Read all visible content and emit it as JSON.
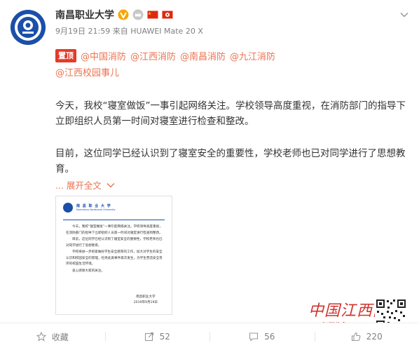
{
  "post": {
    "username": "南昌职业大学",
    "time": "9月19日 21:59",
    "source_prefix": "来自",
    "device": "HUAWEI Mate 20 X",
    "pinned_label": "置顶",
    "mentions_line1": [
      "@中国消防",
      "@江西消防",
      "@南昌消防",
      "@九江消防"
    ],
    "mentions_line2": [
      "@江西校园事儿"
    ],
    "paragraph1": "今天，我校“寝室做饭”一事引起网络关注。学校领导高度重视，在消防部门的指导下立即组织人员第一时间对寝室进行检查和整改。",
    "paragraph2": "目前，这位同学已经认识到了寝室安全的重要性，学校老师也已对同学进行了思想教育。",
    "expand_label": "... 展开全文",
    "image_doc": {
      "title": "南 昌 职 业 大 学",
      "subtitle": "Nanchang Vocational University",
      "body": [
        "今天，我校“寝室做饭”一事引起网络关注。学校领导高度重视，在消防部门的指导下立即组织人员第一时间对寝室进行检查和整改。",
        "目前，这位同学已经认识到了寝室安全的重要性，学校老师也已对同学进行了思想教育。",
        "学校将进一步抓紧做好学生安全教育的工作，加大对学生的安全认识和校园安全的管理，杜绝此类事件再次发生，为学生营造安全有序的校园生活环境。",
        "衷心感谢大家的关注。"
      ],
      "signature": "南昌职业大学",
      "date": "2019年9月19日"
    },
    "watermark_title": "中国江西网",
    "watermark_sub": "江西头条APP"
  },
  "toolbar": {
    "favorite_label": "收藏",
    "repost_count": "52",
    "comment_count": "56",
    "like_count": "220"
  },
  "colors": {
    "link": "#eb7350",
    "pinned_bg": "#e33b27",
    "verified": "#f7a600",
    "text": "#333333",
    "meta": "#808080"
  },
  "icons": {
    "verified": "verified-v-icon",
    "crown": "crown-badge-icon",
    "flag1": "china-flag-icon",
    "flag2": "hongkong-flag-icon",
    "menu": "chevron-down-icon",
    "favorite": "star-icon",
    "repost": "repost-icon",
    "comment": "comment-icon",
    "like": "thumb-up-icon"
  }
}
